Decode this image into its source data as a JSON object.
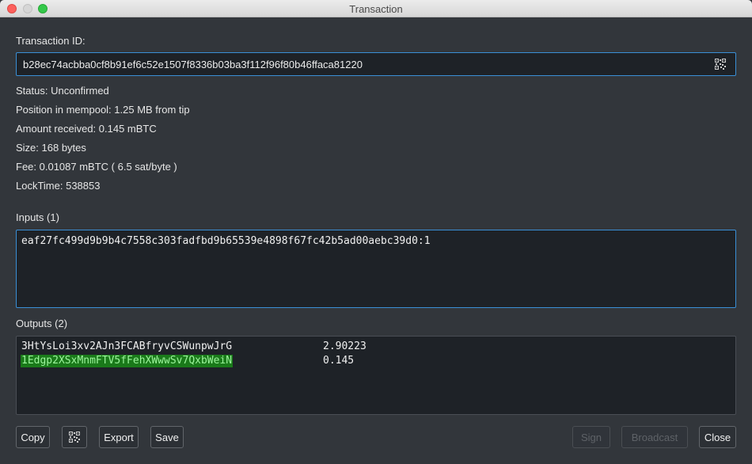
{
  "window": {
    "title": "Transaction"
  },
  "txid": {
    "label": "Transaction ID:",
    "value": "b28ec74acbba0cf8b91ef6c52e1507f8336b03ba3f112f96f80b46ffaca81220",
    "qr_icon": "qr-code-icon"
  },
  "details": {
    "status": "Status: Unconfirmed",
    "mempool": "Position in mempool: 1.25 MB from tip",
    "amount": "Amount received: 0.145 mBTC",
    "size": "Size: 168 bytes",
    "fee": "Fee: 0.01087 mBTC  ( 6.5 sat/byte )",
    "locktime": "LockTime: 538853"
  },
  "inputs": {
    "label": "Inputs (1)",
    "items": [
      "eaf27fc499d9b9b4c7558c303fadfbd9b65539e4898f67fc42b5ad00aebc39d0:1"
    ]
  },
  "outputs": {
    "label": "Outputs (2)",
    "items": [
      {
        "address": "3HtYsLoi3xv2AJn3FCABfryvCSWunpwJrG",
        "amount": "2.90223",
        "highlighted": false
      },
      {
        "address": "1Edgp2XSxMnmFTV5fFehXWwwSv7QxbWeiN",
        "amount": "0.145",
        "highlighted": true
      }
    ],
    "highlight_color": "#1a7a1a"
  },
  "buttons": {
    "copy": "Copy",
    "qr_icon": "qr-code-icon",
    "export": "Export",
    "save": "Save",
    "sign": "Sign",
    "broadcast": "Broadcast",
    "close": "Close"
  },
  "colors": {
    "background": "#32363b",
    "field_bg": "#1e2227",
    "focus_border": "#3a8fd6"
  }
}
